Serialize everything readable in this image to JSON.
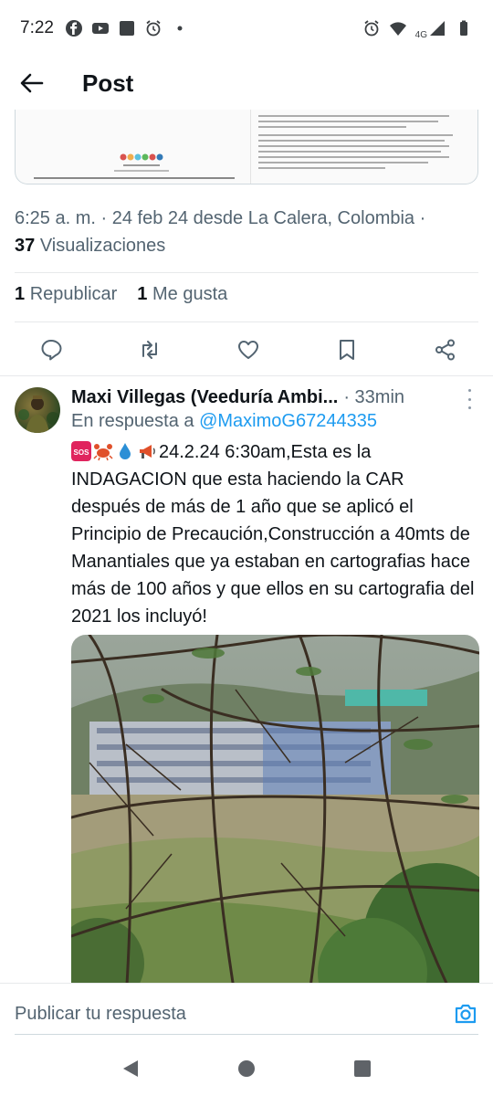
{
  "status_bar": {
    "time": "7:22",
    "left_icons": [
      "facebook-icon",
      "youtube-icon",
      "app-square-icon",
      "alarm-icon",
      "dot-icon"
    ],
    "right_icons": [
      "alarm-icon",
      "wifi-icon",
      "signal-4g-icon",
      "battery-icon"
    ],
    "network_label": "4G"
  },
  "header": {
    "title": "Post",
    "back_icon": "arrow-left-icon"
  },
  "post": {
    "timestamp_line": "6:25 a. m. · 24 feb 24 desde La Calera, Colombia ·",
    "views_count": "37",
    "views_label": "Visualizaciones",
    "reposts_count": "1",
    "reposts_label": "Republicar",
    "likes_count": "1",
    "likes_label": "Me gusta"
  },
  "actions": [
    "reply-icon",
    "repost-icon",
    "like-icon",
    "bookmark-icon",
    "share-icon"
  ],
  "reply": {
    "name": "Maxi Villegas (Veeduría Ambi...",
    "time": "· 33min",
    "reply_prefix": "En respuesta a",
    "reply_handle": "@MaximoG67244335",
    "emojis": [
      "sos-icon",
      "crab-icon",
      "droplet-icon",
      "megaphone-icon"
    ],
    "text": "24.2.24 6:30am,Esta es la INDAGACION que esta haciendo la CAR después de más de 1 año que se aplicó el Principio de Precaución,Construcción a 40mts de Manantiales que ya estaban en cartografias hace más de 100 años y que ellos en su cartografia del 2021 los incluyó!"
  },
  "compose": {
    "placeholder": "Publicar tu respuesta",
    "camera_icon": "camera-icon"
  },
  "nav": [
    "back-triangle-icon",
    "home-circle-icon",
    "recents-square-icon"
  ],
  "colors": {
    "accent": "#1d9bf0",
    "secondary_text": "#536471",
    "primary_text": "#0f1419"
  }
}
